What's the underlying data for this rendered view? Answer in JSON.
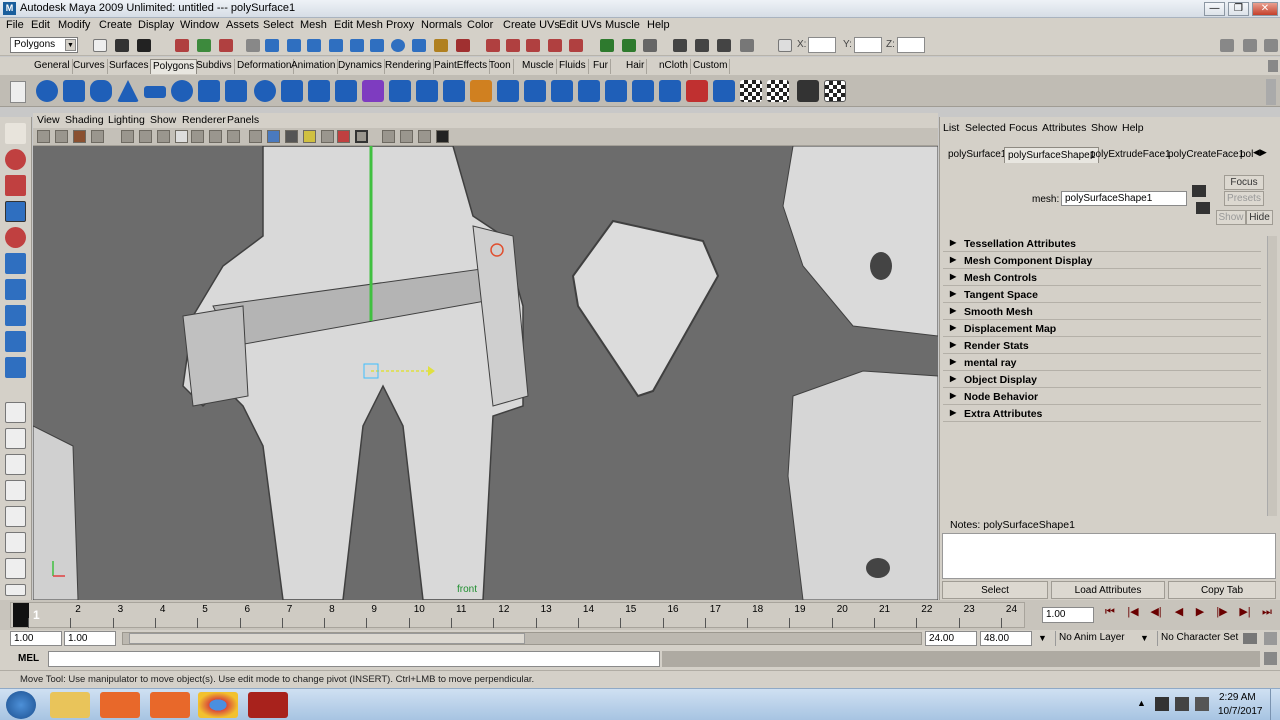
{
  "titlebar": {
    "title": "Autodesk Maya 2009 Unlimited: untitled   ---   polySurface1",
    "min": "—",
    "max": "❐",
    "close": "✕"
  },
  "menu": [
    "File",
    "Edit",
    "Modify",
    "Create",
    "Display",
    "Window",
    "Assets",
    "Select",
    "Mesh",
    "Edit Mesh",
    "Proxy",
    "Normals",
    "Color",
    "Create UVs",
    "Edit UVs",
    "Muscle",
    "Help"
  ],
  "statusline": {
    "mode": "Polygons",
    "x_label": "X:",
    "y_label": "Y:",
    "z_label": "Z:"
  },
  "shelf_tabs": [
    "General",
    "Curves",
    "Surfaces",
    "Polygons",
    "Subdivs",
    "Deformation",
    "Animation",
    "Dynamics",
    "Rendering",
    "PaintEffects",
    "Toon",
    "Muscle",
    "Fluids",
    "Fur",
    "Hair",
    "nCloth",
    "Custom"
  ],
  "view_menu": [
    "View",
    "Shading",
    "Lighting",
    "Show",
    "Renderer",
    "Panels"
  ],
  "viewport": {
    "camera_label": "front"
  },
  "attr": {
    "menu": [
      "List",
      "Selected",
      "Focus",
      "Attributes",
      "Show",
      "Help"
    ],
    "tabs": [
      "polySurface1",
      "polySurfaceShape1",
      "polyExtrudeFace1",
      "polyCreateFace1",
      "pol"
    ],
    "mesh_label": "mesh:",
    "mesh_value": "polySurfaceShape1",
    "focus": "Focus",
    "presets": "Presets",
    "show": "Show",
    "hide": "Hide",
    "sections": [
      "Tessellation Attributes",
      "Mesh Component Display",
      "Mesh Controls",
      "Tangent Space",
      "Smooth Mesh",
      "Displacement Map",
      "Render Stats",
      "mental ray",
      "Object Display",
      "Node Behavior",
      "Extra Attributes"
    ],
    "notes_label": "Notes:  polySurfaceShape1",
    "buttons": [
      "Select",
      "Load Attributes",
      "Copy Tab"
    ]
  },
  "timeline": {
    "ticks": [
      "1",
      "2",
      "3",
      "4",
      "5",
      "6",
      "7",
      "8",
      "9",
      "10",
      "11",
      "12",
      "13",
      "14",
      "15",
      "16",
      "17",
      "18",
      "19",
      "20",
      "21",
      "22",
      "23",
      "24"
    ],
    "current": "1.00"
  },
  "range": {
    "start": "1.00",
    "start2": "1.00",
    "end": "24.00",
    "end2": "48.00",
    "anim_layer": "No Anim Layer",
    "char_set": "No Character Set"
  },
  "cmd": {
    "label": "MEL"
  },
  "help": {
    "text": "Move Tool: Use manipulator to move object(s). Use edit mode to change pivot (INSERT).  Ctrl+LMB to move perpendicular."
  },
  "taskbar": {
    "time": "2:29 AM",
    "date": "10/7/2017"
  },
  "colors": {
    "viewport_bg": "#6c6c6c",
    "panel_bg": "#d4d0c8",
    "taskbar": "#b5cde8"
  }
}
